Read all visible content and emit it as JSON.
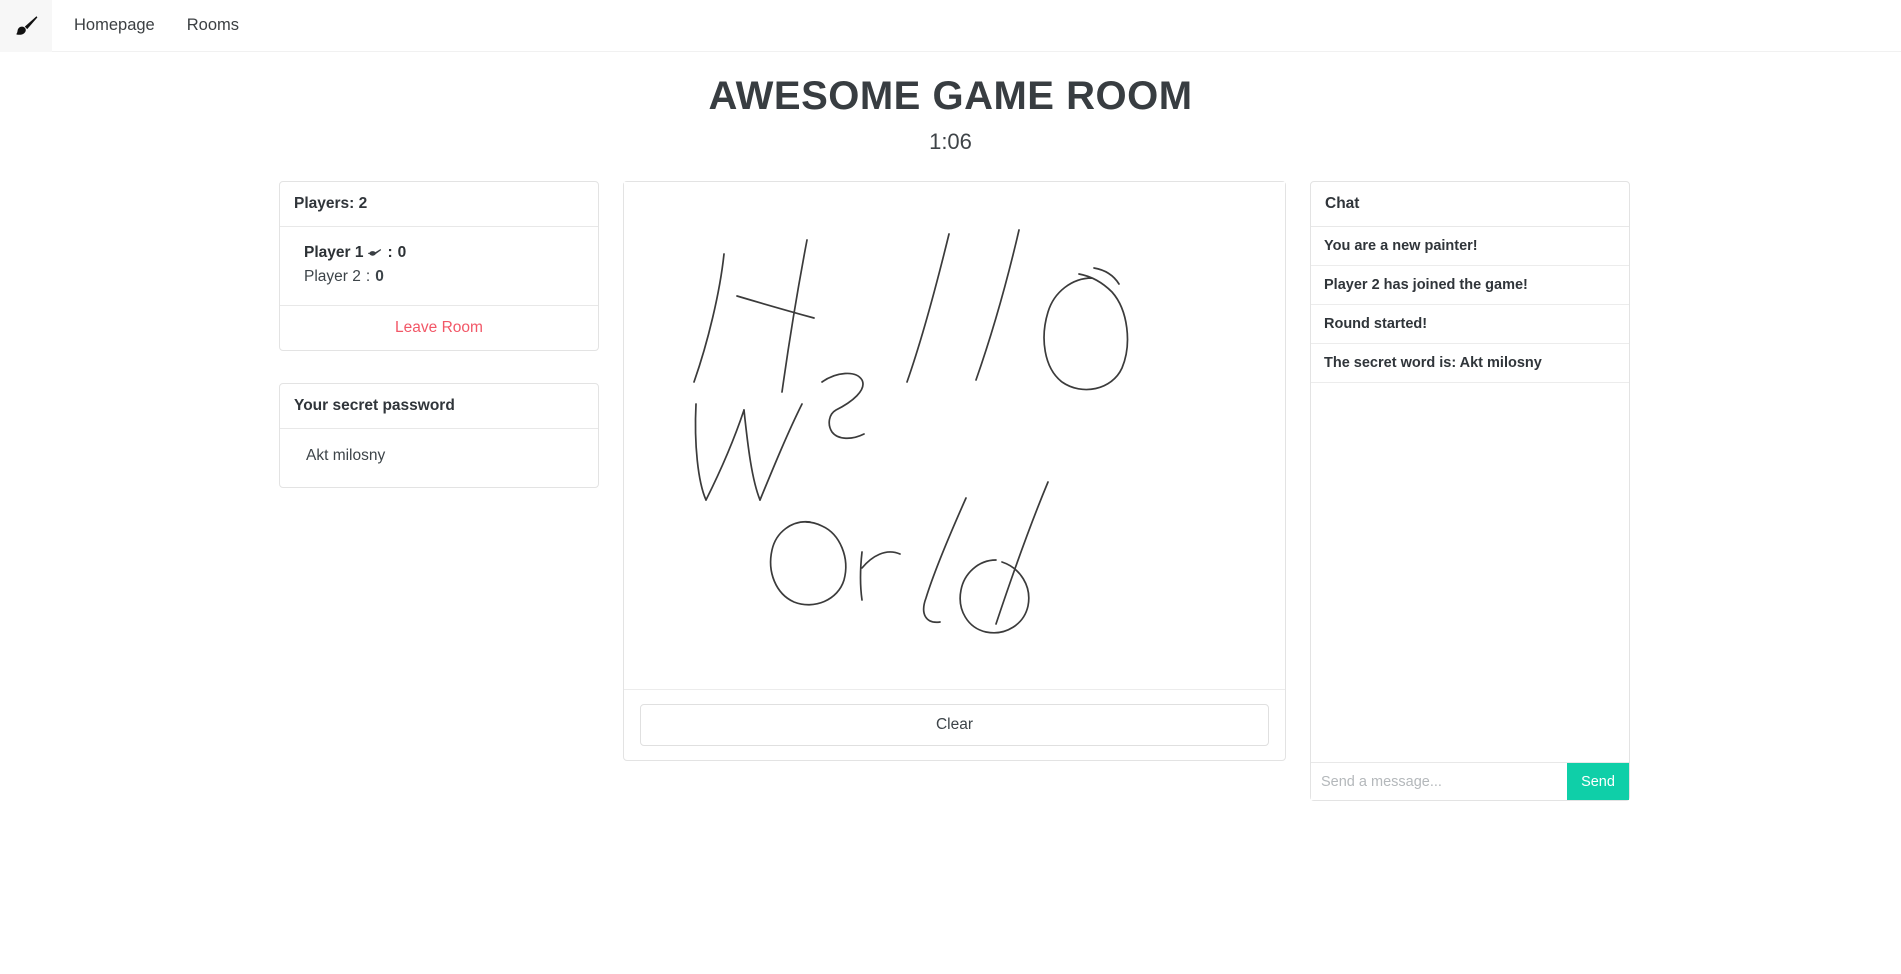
{
  "navbar": {
    "brand_icon": "paintbrush-icon",
    "links": [
      {
        "label": "Homepage"
      },
      {
        "label": "Rooms"
      }
    ]
  },
  "header": {
    "title": "AWESOME GAME ROOM",
    "timer": "1:06"
  },
  "players_panel": {
    "header": "Players: 2",
    "players": [
      {
        "name": "Player 1",
        "score": "0",
        "is_painter": true,
        "painter_icon": "paintbrush-icon",
        "separator": ": "
      },
      {
        "name": "Player 2",
        "score": "0",
        "is_painter": false,
        "separator": ": "
      }
    ],
    "leave_label": "Leave Room"
  },
  "secret_panel": {
    "header": "Your secret password",
    "word": "Akt milosny"
  },
  "canvas_panel": {
    "drawing_text": "Hello World",
    "clear_label": "Clear",
    "stroke_color": "#3b3b3b"
  },
  "chat_panel": {
    "header": "Chat",
    "messages": [
      {
        "text": "You are a new painter!"
      },
      {
        "text": "Player 2 has joined the game!"
      },
      {
        "text": "Round started!"
      },
      {
        "text": "The secret word is: Akt milosny"
      }
    ],
    "input_placeholder": "Send a message...",
    "input_value": "",
    "send_label": "Send"
  },
  "colors": {
    "accent_teal": "#0fcfa8",
    "danger_red": "#f25767",
    "text_dark": "#30353a",
    "border": "#e3e3e3"
  }
}
